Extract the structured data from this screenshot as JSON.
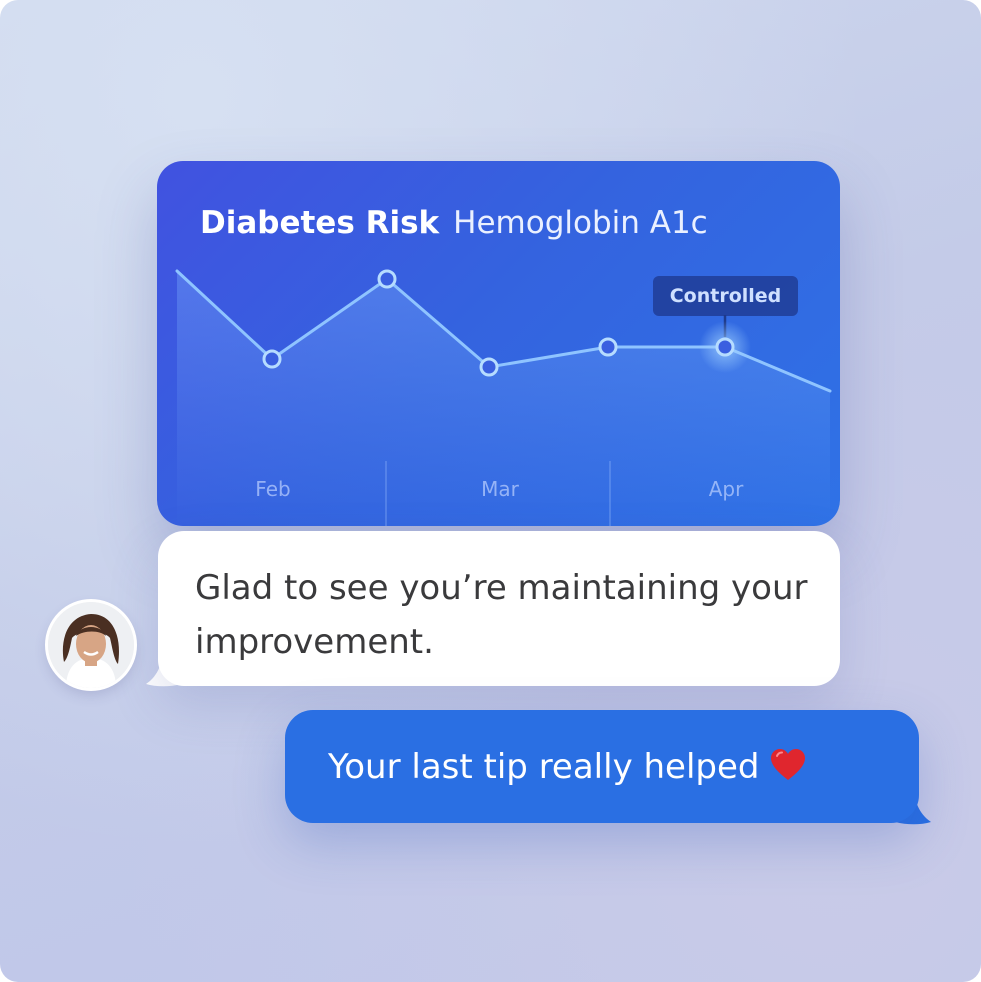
{
  "chart_card": {
    "title_bold": "Diabetes Risk",
    "title_light": "Hemoglobin A1c",
    "badge": "Controlled",
    "months": [
      "Feb",
      "Mar",
      "Apr"
    ]
  },
  "chart_data": {
    "type": "line",
    "title": "Diabetes Risk Hemoglobin A1c",
    "categories": [
      "Feb",
      "Mar",
      "Apr"
    ],
    "series": [
      {
        "values": [
          0.8,
          0.58,
          0.78,
          0.56,
          0.61,
          0.61,
          0.5
        ]
      }
    ],
    "highlighted_label": "Controlled",
    "grid": false
  },
  "messages": {
    "incoming": {
      "text": "Glad to see you’re maintaining your improvement."
    },
    "outgoing": {
      "text": "Your last tip really helped"
    }
  },
  "colors": {
    "card_gradient_start": "#4152e0",
    "card_gradient_end": "#2f72e6",
    "line": "#8fc4ff",
    "outgoing_bubble": "#2a6fe3",
    "incoming_bubble": "#ffffff",
    "heart": "#e0262e"
  },
  "icons": {
    "heart": "heart-icon",
    "avatar": "avatar"
  }
}
